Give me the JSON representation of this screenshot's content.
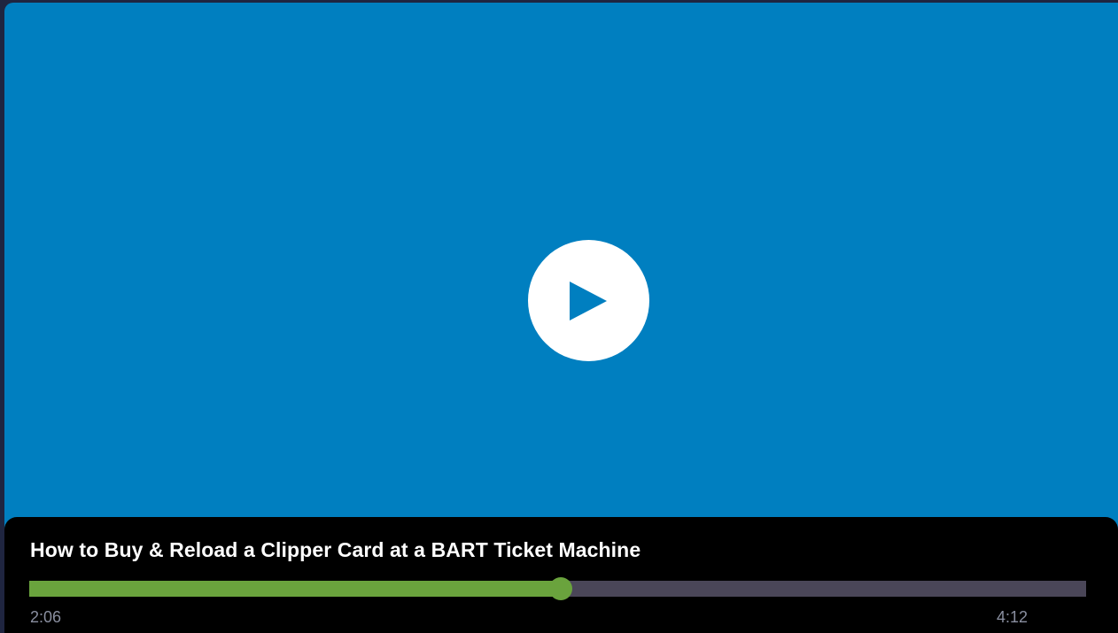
{
  "video": {
    "title": "How to Buy & Reload a Clipper Card at a BART Ticket Machine",
    "current_time": "2:06",
    "duration": "4:12",
    "progress_fraction": 0.503,
    "play_icon": "play-icon"
  },
  "colors": {
    "video_background": "#007fc0",
    "page_background": "#1f2540",
    "control_bar": "#000000",
    "progress_played": "#6aa33d",
    "progress_track": "#4a4658",
    "time_text": "#8a8fa0",
    "play_button": "#ffffff",
    "play_glyph": "#007fc0"
  }
}
